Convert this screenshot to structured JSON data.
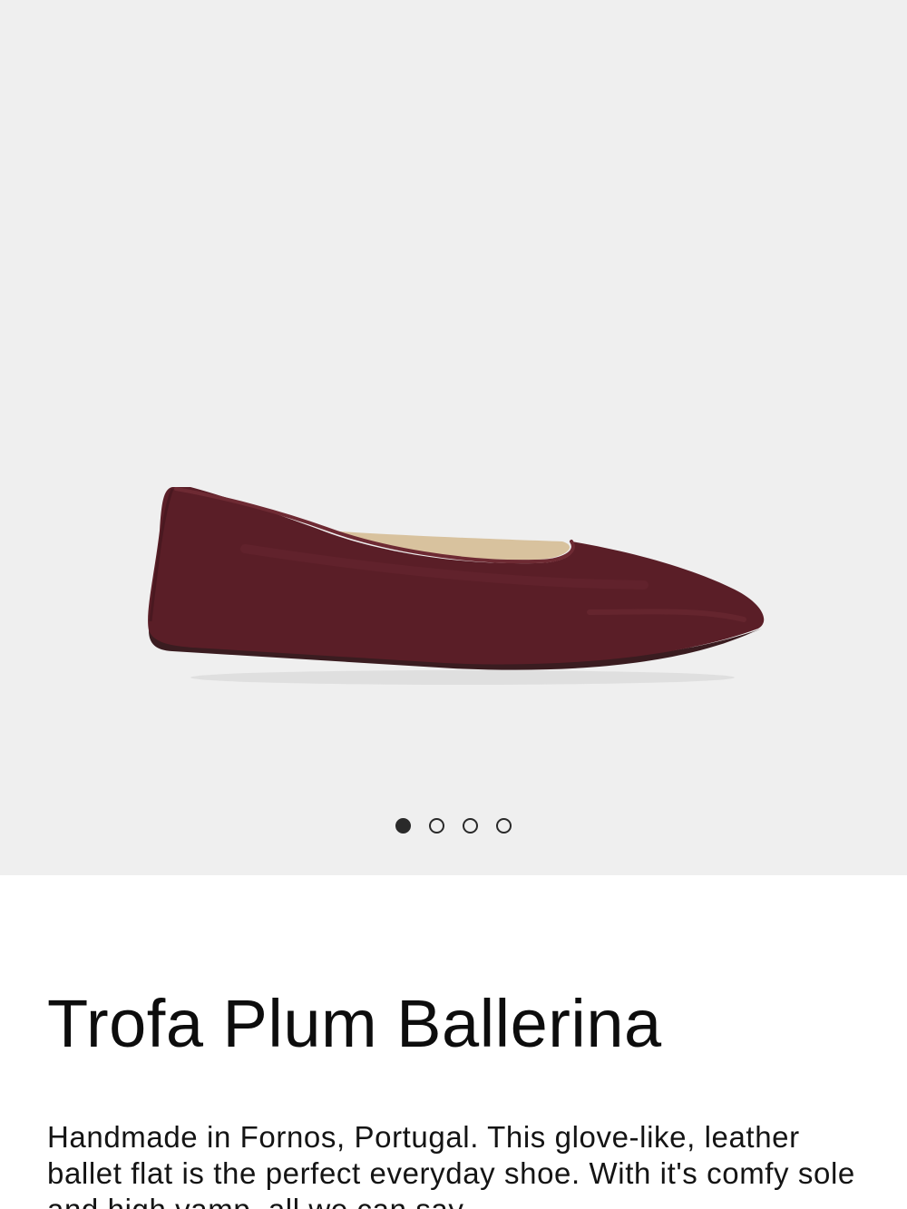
{
  "product": {
    "title": "Trofa Plum Ballerina",
    "description": "Handmade in Fornos, Portugal. This glove-like, leather ballet flat is the perfect everyday shoe. With it's comfy sole and high vamp, all we can say"
  },
  "gallery": {
    "image_alt": "Trofa Plum Ballerina shoe",
    "slide_count": 4,
    "active_slide": 1,
    "dots": [
      {
        "label": "Slide 1",
        "active": true
      },
      {
        "label": "Slide 2",
        "active": false
      },
      {
        "label": "Slide 3",
        "active": false
      },
      {
        "label": "Slide 4",
        "active": false
      }
    ]
  },
  "colors": {
    "gallery_background": "#efefef",
    "shoe_leather": "#5a1e27",
    "shoe_lining": "#d8c29e",
    "dot": "#2a2a2a"
  }
}
